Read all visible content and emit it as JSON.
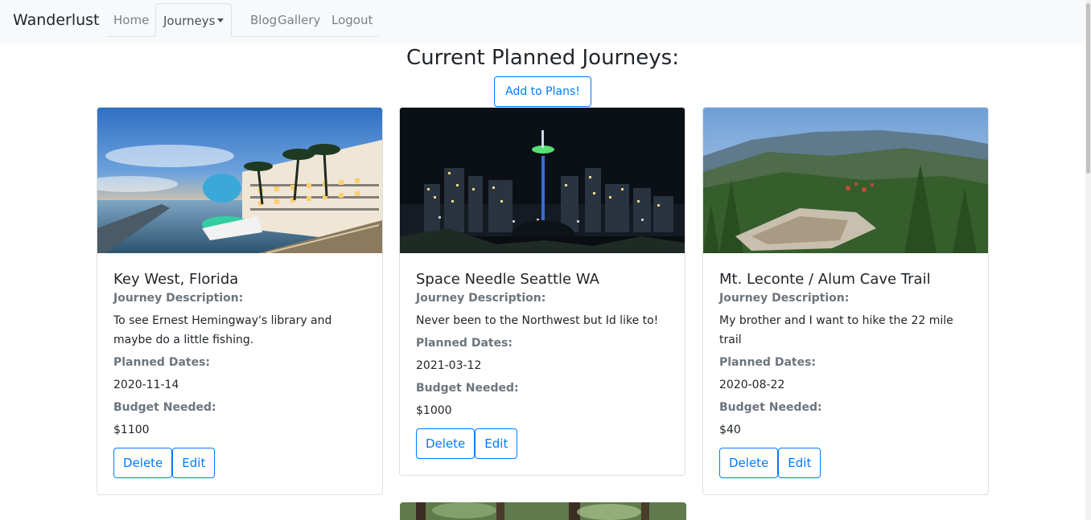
{
  "navbar": {
    "brand": "Wanderlust",
    "links": [
      {
        "label": "Home"
      },
      {
        "label": "Journeys"
      },
      {
        "label": "Blog"
      },
      {
        "label": "Gallery"
      },
      {
        "label": "Logout"
      }
    ]
  },
  "main": {
    "title": "Current Planned Journeys:",
    "add_button": "Add to Plans!"
  },
  "labels": {
    "description": "Journey Description:",
    "dates": "Planned Dates:",
    "budget": "Budget Needed:",
    "delete": "Delete",
    "edit": "Edit"
  },
  "cards": [
    {
      "title": "Key West, Florida",
      "description": "To see Ernest Hemingway's library and maybe do a little fishing.",
      "date": "2020-11-14",
      "budget": "$1100"
    },
    {
      "title": "Space Needle Seattle WA",
      "description": "Never been to the Northwest but Id like to!",
      "date": "2021-03-12",
      "budget": "$1000"
    },
    {
      "title": "Mt. Leconte / Alum Cave Trail",
      "description": "My brother and I want to hike the 22 mile trail",
      "date": "2020-08-22",
      "budget": "$40"
    }
  ]
}
